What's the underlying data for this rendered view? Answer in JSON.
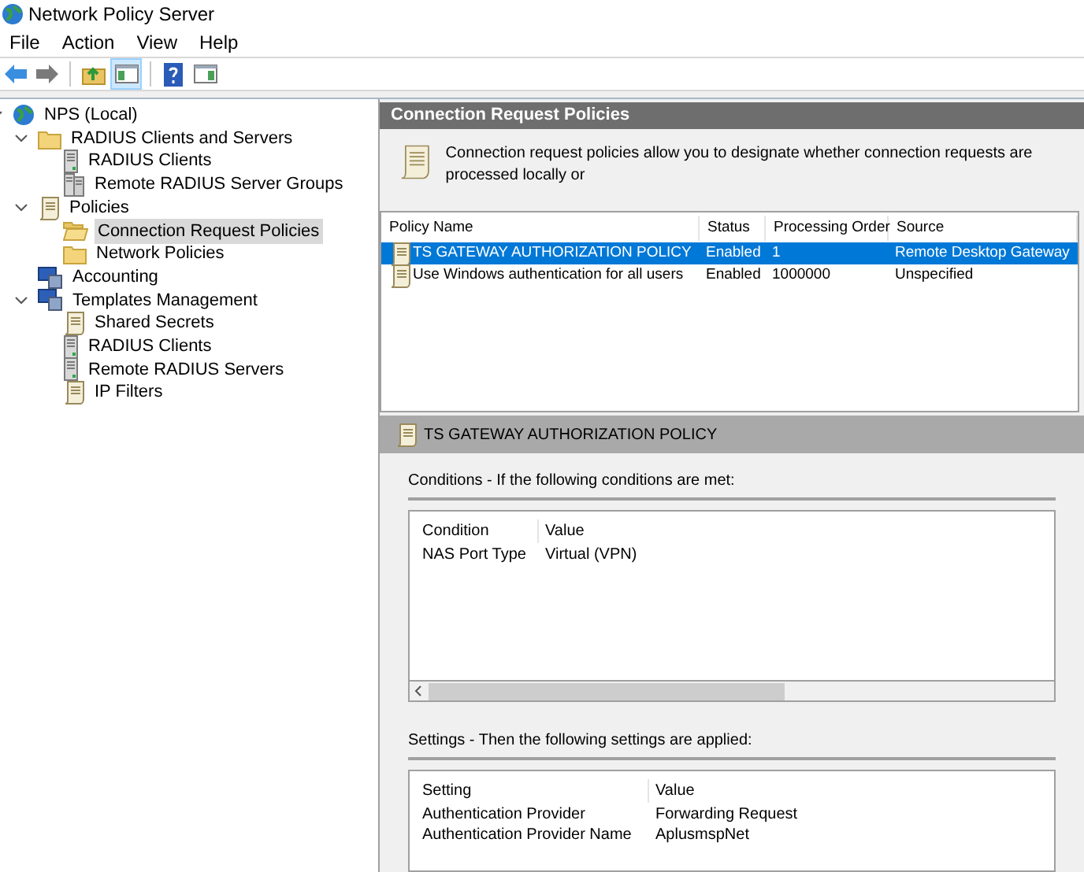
{
  "window": {
    "title": "Network Policy Server"
  },
  "menu": [
    "File",
    "Action",
    "View",
    "Help"
  ],
  "toolbar": [
    {
      "kind": "back"
    },
    {
      "kind": "forward"
    },
    {
      "kind": "sep"
    },
    {
      "kind": "up"
    },
    {
      "kind": "pane",
      "selected": true
    },
    {
      "kind": "sep"
    },
    {
      "kind": "help"
    },
    {
      "kind": "pane2"
    }
  ],
  "tree": [
    {
      "label": "NPS (Local)",
      "kind": "globe",
      "expanded": true,
      "selected": false,
      "children": [
        {
          "label": "RADIUS Clients and Servers",
          "kind": "folder",
          "expanded": true,
          "selected": false,
          "children": [
            {
              "label": "RADIUS Clients",
              "kind": "server",
              "selected": false
            },
            {
              "label": "Remote RADIUS Server Groups",
              "kind": "servers",
              "selected": false
            }
          ]
        },
        {
          "label": "Policies",
          "kind": "scroll",
          "expanded": true,
          "selected": false,
          "children": [
            {
              "label": "Connection Request Policies",
              "kind": "openfolder",
              "selected": true
            },
            {
              "label": "Network Policies",
              "kind": "folder",
              "selected": false
            }
          ]
        },
        {
          "label": "Accounting",
          "kind": "monitor",
          "selected": false
        },
        {
          "label": "Templates Management",
          "kind": "monitor",
          "expanded": true,
          "selected": false,
          "children": [
            {
              "label": "Shared Secrets",
              "kind": "scroll",
              "selected": false
            },
            {
              "label": "RADIUS Clients",
              "kind": "server",
              "selected": false
            },
            {
              "label": "Remote RADIUS Servers",
              "kind": "server",
              "selected": false
            },
            {
              "label": "IP Filters",
              "kind": "scroll",
              "selected": false
            }
          ]
        }
      ]
    }
  ],
  "content": {
    "title": "Connection Request Policies",
    "description": "Connection request policies allow you to designate whether connection requests are processed locally or",
    "table": {
      "columns": [
        "Policy Name",
        "Status",
        "Processing Order",
        "Source"
      ],
      "rows": [
        {
          "cells": [
            "TS GATEWAY AUTHORIZATION POLICY",
            "Enabled",
            "1",
            "Remote Desktop Gateway"
          ],
          "selected": true
        },
        {
          "cells": [
            "Use Windows authentication for all users",
            "Enabled",
            "1000000",
            "Unspecified"
          ],
          "selected": false
        }
      ]
    },
    "detail": {
      "title": "TS GATEWAY AUTHORIZATION POLICY",
      "conditions": {
        "heading": "Conditions - If the following conditions are met:",
        "columns": [
          "Condition",
          "Value"
        ],
        "rows": [
          [
            "NAS Port Type",
            "Virtual (VPN)"
          ]
        ]
      },
      "settings": {
        "heading": "Settings - Then the following settings are applied:",
        "columns": [
          "Setting",
          "Value"
        ],
        "rows": [
          [
            "Authentication Provider",
            "Forwarding Request"
          ],
          [
            "Authentication Provider Name",
            "AplusmspNet"
          ]
        ]
      }
    }
  }
}
